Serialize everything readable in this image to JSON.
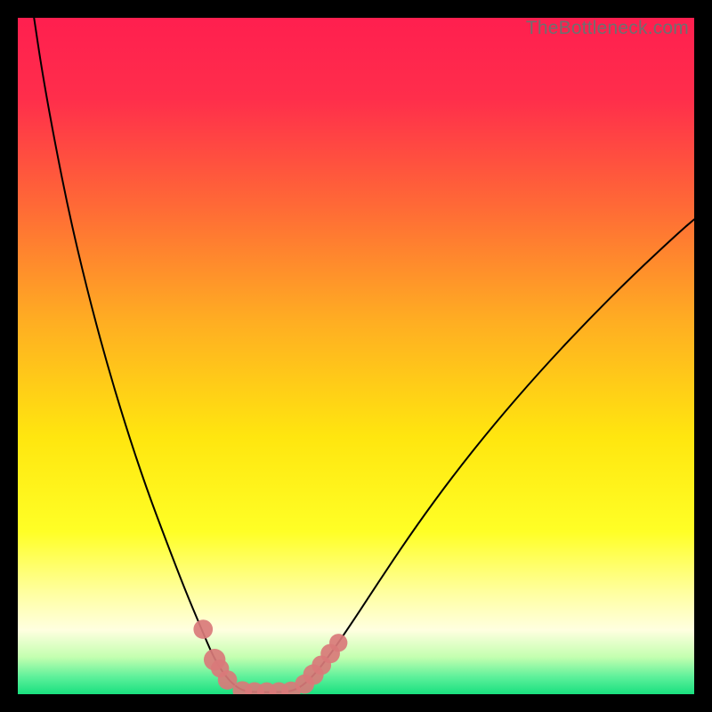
{
  "watermark": "TheBottleneck.com",
  "chart_data": {
    "type": "line",
    "title": "",
    "xlabel": "",
    "ylabel": "",
    "xlim": [
      0,
      100
    ],
    "ylim": [
      0,
      100
    ],
    "background_gradient": {
      "stops": [
        {
          "offset": 0.0,
          "color": "#ff1f4f"
        },
        {
          "offset": 0.12,
          "color": "#ff2e4b"
        },
        {
          "offset": 0.28,
          "color": "#ff6a36"
        },
        {
          "offset": 0.45,
          "color": "#ffae22"
        },
        {
          "offset": 0.62,
          "color": "#ffe60f"
        },
        {
          "offset": 0.76,
          "color": "#ffff26"
        },
        {
          "offset": 0.85,
          "color": "#ffffa0"
        },
        {
          "offset": 0.905,
          "color": "#ffffe0"
        },
        {
          "offset": 0.945,
          "color": "#c4ffb0"
        },
        {
          "offset": 0.975,
          "color": "#5cf09a"
        },
        {
          "offset": 1.0,
          "color": "#19e07f"
        }
      ]
    },
    "series": [
      {
        "name": "bottleneck-curve-left",
        "stroke": "#000000",
        "points": [
          {
            "x": 2.4,
            "y": 100.0
          },
          {
            "x": 3.6,
            "y": 92.0
          },
          {
            "x": 5.4,
            "y": 82.0
          },
          {
            "x": 7.6,
            "y": 71.0
          },
          {
            "x": 10.2,
            "y": 60.0
          },
          {
            "x": 13.0,
            "y": 49.5
          },
          {
            "x": 16.0,
            "y": 39.5
          },
          {
            "x": 19.0,
            "y": 30.5
          },
          {
            "x": 22.0,
            "y": 22.5
          },
          {
            "x": 24.7,
            "y": 15.5
          },
          {
            "x": 27.0,
            "y": 10.0
          },
          {
            "x": 29.0,
            "y": 5.3
          },
          {
            "x": 30.8,
            "y": 2.5
          },
          {
            "x": 32.5,
            "y": 0.9
          },
          {
            "x": 34.0,
            "y": 0.35
          }
        ]
      },
      {
        "name": "bottleneck-curve-flat",
        "stroke": "#000000",
        "points": [
          {
            "x": 34.0,
            "y": 0.35
          },
          {
            "x": 36.0,
            "y": 0.3
          },
          {
            "x": 38.0,
            "y": 0.3
          },
          {
            "x": 40.0,
            "y": 0.35
          }
        ]
      },
      {
        "name": "bottleneck-curve-right",
        "stroke": "#000000",
        "points": [
          {
            "x": 40.0,
            "y": 0.35
          },
          {
            "x": 41.6,
            "y": 0.9
          },
          {
            "x": 43.5,
            "y": 2.5
          },
          {
            "x": 46.0,
            "y": 5.6
          },
          {
            "x": 49.5,
            "y": 10.7
          },
          {
            "x": 54.0,
            "y": 17.6
          },
          {
            "x": 59.0,
            "y": 25.0
          },
          {
            "x": 64.5,
            "y": 32.5
          },
          {
            "x": 70.5,
            "y": 40.0
          },
          {
            "x": 77.0,
            "y": 47.5
          },
          {
            "x": 84.0,
            "y": 55.0
          },
          {
            "x": 91.0,
            "y": 62.0
          },
          {
            "x": 98.0,
            "y": 68.5
          },
          {
            "x": 100.0,
            "y": 70.2
          }
        ]
      }
    ],
    "markers": [
      {
        "x": 27.4,
        "y": 9.6,
        "r": 1.0,
        "color": "#d97a7a"
      },
      {
        "x": 29.1,
        "y": 5.1,
        "r": 1.2,
        "color": "#d97a7a"
      },
      {
        "x": 29.9,
        "y": 3.8,
        "r": 0.9,
        "color": "#d97a7a"
      },
      {
        "x": 31.0,
        "y": 2.1,
        "r": 1.0,
        "color": "#d97a7a"
      },
      {
        "x": 33.2,
        "y": 0.5,
        "r": 1.0,
        "color": "#d97a7a"
      },
      {
        "x": 35.0,
        "y": 0.35,
        "r": 1.0,
        "color": "#d97a7a"
      },
      {
        "x": 36.8,
        "y": 0.33,
        "r": 1.0,
        "color": "#d97a7a"
      },
      {
        "x": 38.6,
        "y": 0.35,
        "r": 1.0,
        "color": "#d97a7a"
      },
      {
        "x": 40.4,
        "y": 0.45,
        "r": 1.0,
        "color": "#d97a7a"
      },
      {
        "x": 42.4,
        "y": 1.5,
        "r": 1.0,
        "color": "#d97a7a"
      },
      {
        "x": 43.7,
        "y": 2.9,
        "r": 1.1,
        "color": "#d97a7a"
      },
      {
        "x": 44.9,
        "y": 4.3,
        "r": 1.0,
        "color": "#d97a7a"
      },
      {
        "x": 46.2,
        "y": 6.0,
        "r": 1.0,
        "color": "#d97a7a"
      },
      {
        "x": 47.4,
        "y": 7.6,
        "r": 0.9,
        "color": "#d97a7a"
      }
    ]
  }
}
